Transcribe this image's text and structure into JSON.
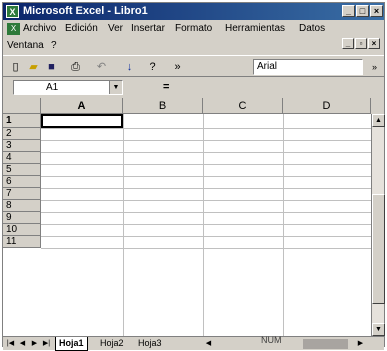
{
  "window": {
    "title": "Microsoft Excel - Libro1",
    "icon": "excel-icon"
  },
  "menu": {
    "items": [
      "Archivo",
      "Edición",
      "Ver",
      "Insertar",
      "Formato",
      "Herramientas",
      "Datos",
      "Ventana",
      "?"
    ]
  },
  "toolbar": {
    "font_name": "Arial",
    "buttons": [
      "new-file-icon",
      "open-folder-icon",
      "save-icon",
      "print-icon",
      "undo-icon",
      "sort-ascending-icon",
      "help-icon",
      "more-buttons-icon"
    ]
  },
  "formula_bar": {
    "cell_ref": "A1",
    "equals": "="
  },
  "grid": {
    "columns": [
      "A",
      "B",
      "C",
      "D"
    ],
    "rows": [
      "1",
      "2",
      "3",
      "4",
      "5",
      "6",
      "7",
      "8",
      "9",
      "10",
      "11"
    ],
    "selected_cell": "A1"
  },
  "sheets": {
    "tabs": [
      "Hoja1",
      "Hoja2",
      "Hoja3"
    ],
    "active": "Hoja1"
  },
  "status": {
    "num": "NUM"
  }
}
